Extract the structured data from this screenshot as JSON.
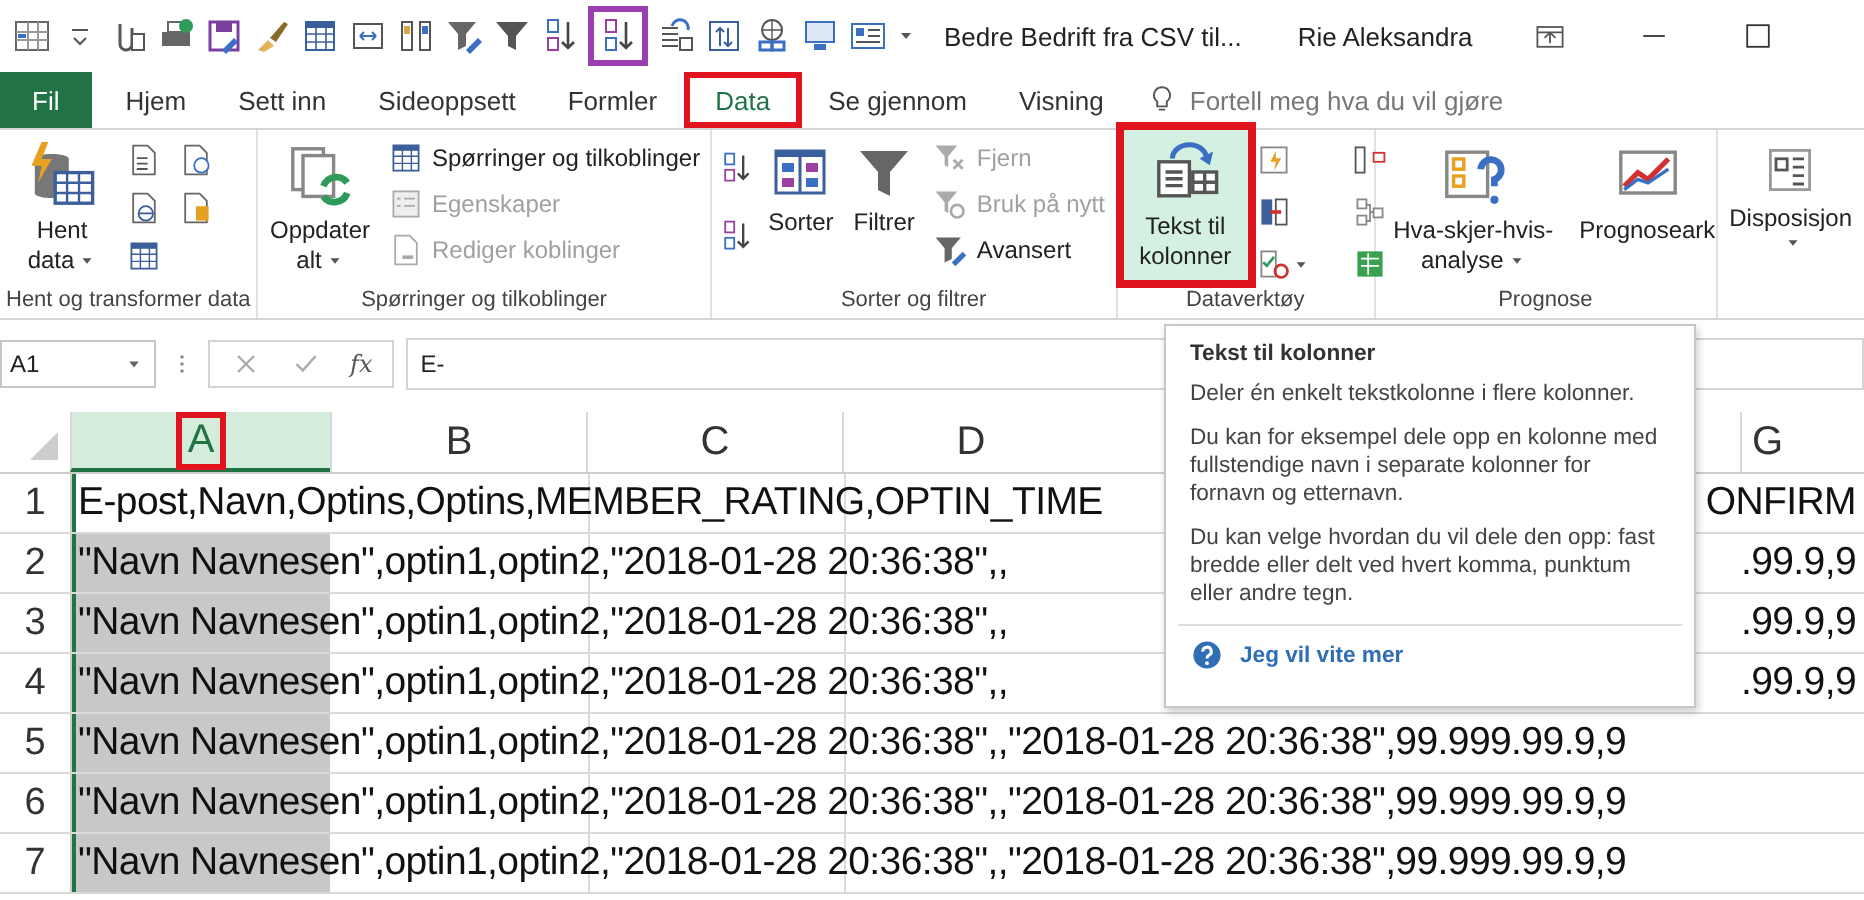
{
  "quick_access_toolbar": [
    {
      "marked": false
    },
    {
      "marked": false
    },
    {
      "marked": false
    },
    {
      "marked": false
    },
    {
      "marked": false
    },
    {
      "marked": false
    },
    {
      "marked": false
    },
    {
      "marked": false
    },
    {
      "marked": false
    },
    {
      "marked": false
    },
    {
      "marked": false
    },
    {
      "marked": false
    },
    {
      "marked": true
    },
    {
      "marked": false
    },
    {
      "marked": false
    },
    {
      "marked": false
    },
    {
      "marked": false
    },
    {
      "marked": false
    }
  ],
  "title_bar": {
    "document_title": "Bedre Bedrift fra CSV til...",
    "user": "Rie Aleksandra"
  },
  "tabs": [
    {
      "label": "Fil",
      "kind": "file",
      "selected": false,
      "marked": false
    },
    {
      "label": "Hjem",
      "kind": "tab",
      "selected": false,
      "marked": false
    },
    {
      "label": "Sett inn",
      "kind": "tab",
      "selected": false,
      "marked": false
    },
    {
      "label": "Sideoppsett",
      "kind": "tab",
      "selected": false,
      "marked": false
    },
    {
      "label": "Formler",
      "kind": "tab",
      "selected": false,
      "marked": false
    },
    {
      "label": "Data",
      "kind": "tab",
      "selected": true,
      "marked": true
    },
    {
      "label": "Se gjennom",
      "kind": "tab",
      "selected": false,
      "marked": false
    },
    {
      "label": "Visning",
      "kind": "tab",
      "selected": false,
      "marked": false
    }
  ],
  "tell_me": {
    "placeholder": "Fortell meg hva du vil gjøre"
  },
  "ribbon_groups": [
    {
      "label": "Hent og transformer data",
      "buttons": [
        {
          "label": "Hent data",
          "dropdown": true,
          "disabled": false
        }
      ]
    },
    {
      "label": "Spørringer og tilkoblinger",
      "buttons": [
        {
          "label": "Oppdater alt",
          "dropdown": true,
          "disabled": false
        },
        {
          "label": "Spørringer og tilkoblinger",
          "disabled": false
        },
        {
          "label": "Egenskaper",
          "disabled": true
        },
        {
          "label": "Rediger koblinger",
          "disabled": true
        }
      ]
    },
    {
      "label": "Sorter og filtrer",
      "buttons": [
        {
          "label": "Sorter",
          "disabled": false
        },
        {
          "label": "Filtrer",
          "disabled": false
        },
        {
          "label": "Fjern",
          "disabled": true
        },
        {
          "label": "Bruk på nytt",
          "disabled": true
        },
        {
          "label": "Avansert",
          "disabled": false
        }
      ]
    },
    {
      "label": "Dataverktøy",
      "buttons": [
        {
          "label": "Tekst til kolonner",
          "disabled": false,
          "hovered": true,
          "marked": true
        }
      ]
    },
    {
      "label": "Prognose",
      "buttons": [
        {
          "label": "Hva-skjer-hvis-analyse",
          "dropdown": true,
          "disabled": false
        },
        {
          "label": "Prognoseark",
          "disabled": false
        }
      ]
    },
    {
      "buttons": [
        {
          "label": "Disposisjon",
          "dropdown": true,
          "disabled": false
        }
      ]
    }
  ],
  "formula_bar": {
    "name_box": "A1",
    "function_label": "fx",
    "value": "E-"
  },
  "sheet": {
    "columns": [
      {
        "label": "A",
        "selected": true,
        "marked": true
      },
      {
        "label": "B",
        "selected": false,
        "marked": false
      },
      {
        "label": "C",
        "selected": false,
        "marked": false
      },
      {
        "label": "D",
        "selected": false,
        "marked": false
      },
      {
        "label": "G",
        "selected": false,
        "marked": false
      }
    ],
    "rows": [
      {
        "number": "1",
        "text": "E-post,Navn,Optins,Optins,MEMBER_RATING,OPTIN_TIME",
        "text_after_tooltip": "ONFIRM"
      },
      {
        "number": "2",
        "text": "\"Navn Navnesen\",optin1,optin2,\"2018-01-28 20:36:38\",,",
        "text_after_tooltip": ".99.9,9"
      },
      {
        "number": "3",
        "text": "\"Navn Navnesen\",optin1,optin2,\"2018-01-28 20:36:38\",,",
        "text_after_tooltip": ".99.9,9"
      },
      {
        "number": "4",
        "text": "\"Navn Navnesen\",optin1,optin2,\"2018-01-28 20:36:38\",,",
        "text_after_tooltip": ".99.9,9"
      },
      {
        "number": "5",
        "text": "\"Navn Navnesen\",optin1,optin2,\"2018-01-28 20:36:38\",,\"2018-01-28 20:36:38\",99.999.99.9,9"
      },
      {
        "number": "6",
        "text": "\"Navn Navnesen\",optin1,optin2,\"2018-01-28 20:36:38\",,\"2018-01-28 20:36:38\",99.999.99.9,9"
      },
      {
        "number": "7",
        "text": "\"Navn Navnesen\",optin1,optin2,\"2018-01-28 20:36:38\",,\"2018-01-28 20:36:38\",99.999.99.9,9"
      }
    ]
  },
  "tooltip": {
    "title": "Tekst til kolonner",
    "paragraphs": [
      "Deler én enkelt tekstkolonne i flere kolonner.",
      "Du kan for eksempel dele opp en kolonne med fullstendige navn i separate kolonner for fornavn og etternavn.",
      "Du kan velge hvordan du vil dele den opp: fast bredde eller delt ved hvert komma, punktum eller andre tegn."
    ],
    "link": "Jeg vil vite mer"
  }
}
